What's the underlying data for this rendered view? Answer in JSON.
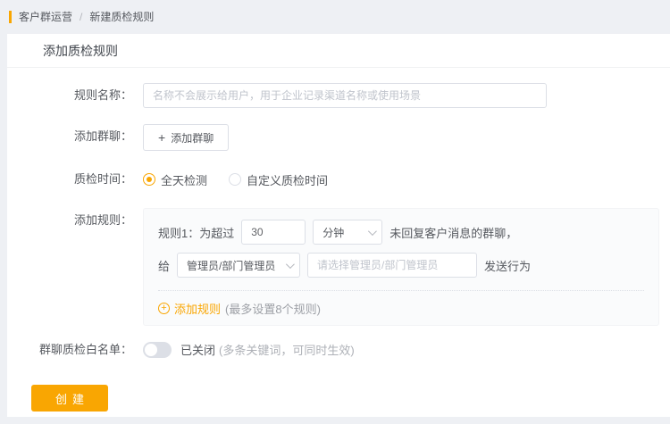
{
  "accent_color": "#f9a602",
  "breadcrumb": {
    "section": "客户群运营",
    "separator": "/",
    "current": "新建质检规则"
  },
  "page": {
    "title": "添加质检规则"
  },
  "icons": {
    "plus": "+",
    "circle_plus": "+"
  },
  "form": {
    "rule_name": {
      "label": "规则名称：",
      "placeholder": "名称不会展示给用户，用于企业记录渠道名称或使用场景"
    },
    "add_group": {
      "label": "添加群聊：",
      "button_label": "添加群聊"
    },
    "inspect_time": {
      "label": "质检时间：",
      "options": [
        {
          "label": "全天检测",
          "selected": true
        },
        {
          "label": "自定义质检时间",
          "selected": false
        }
      ]
    },
    "add_rules": {
      "label": "添加规则：",
      "rule1": {
        "prefix": "规则1：为超过",
        "minutes_value": "30",
        "unit_value": "分钟",
        "suffix": "未回复客户消息的群聊，"
      },
      "rule2": {
        "prefix": "给",
        "receiver_value": "管理员/部门管理员",
        "receiver_placeholder": "请选择管理员/部门管理员",
        "suffix": "发送行为"
      },
      "add_link": "添加规则",
      "add_hint": "(最多设置8个规则)"
    },
    "whitelist": {
      "label": "群聊质检白名单：",
      "status": "已关闭",
      "hint": "(多条关键词，可同时生效)"
    },
    "submit_label": "创建"
  }
}
